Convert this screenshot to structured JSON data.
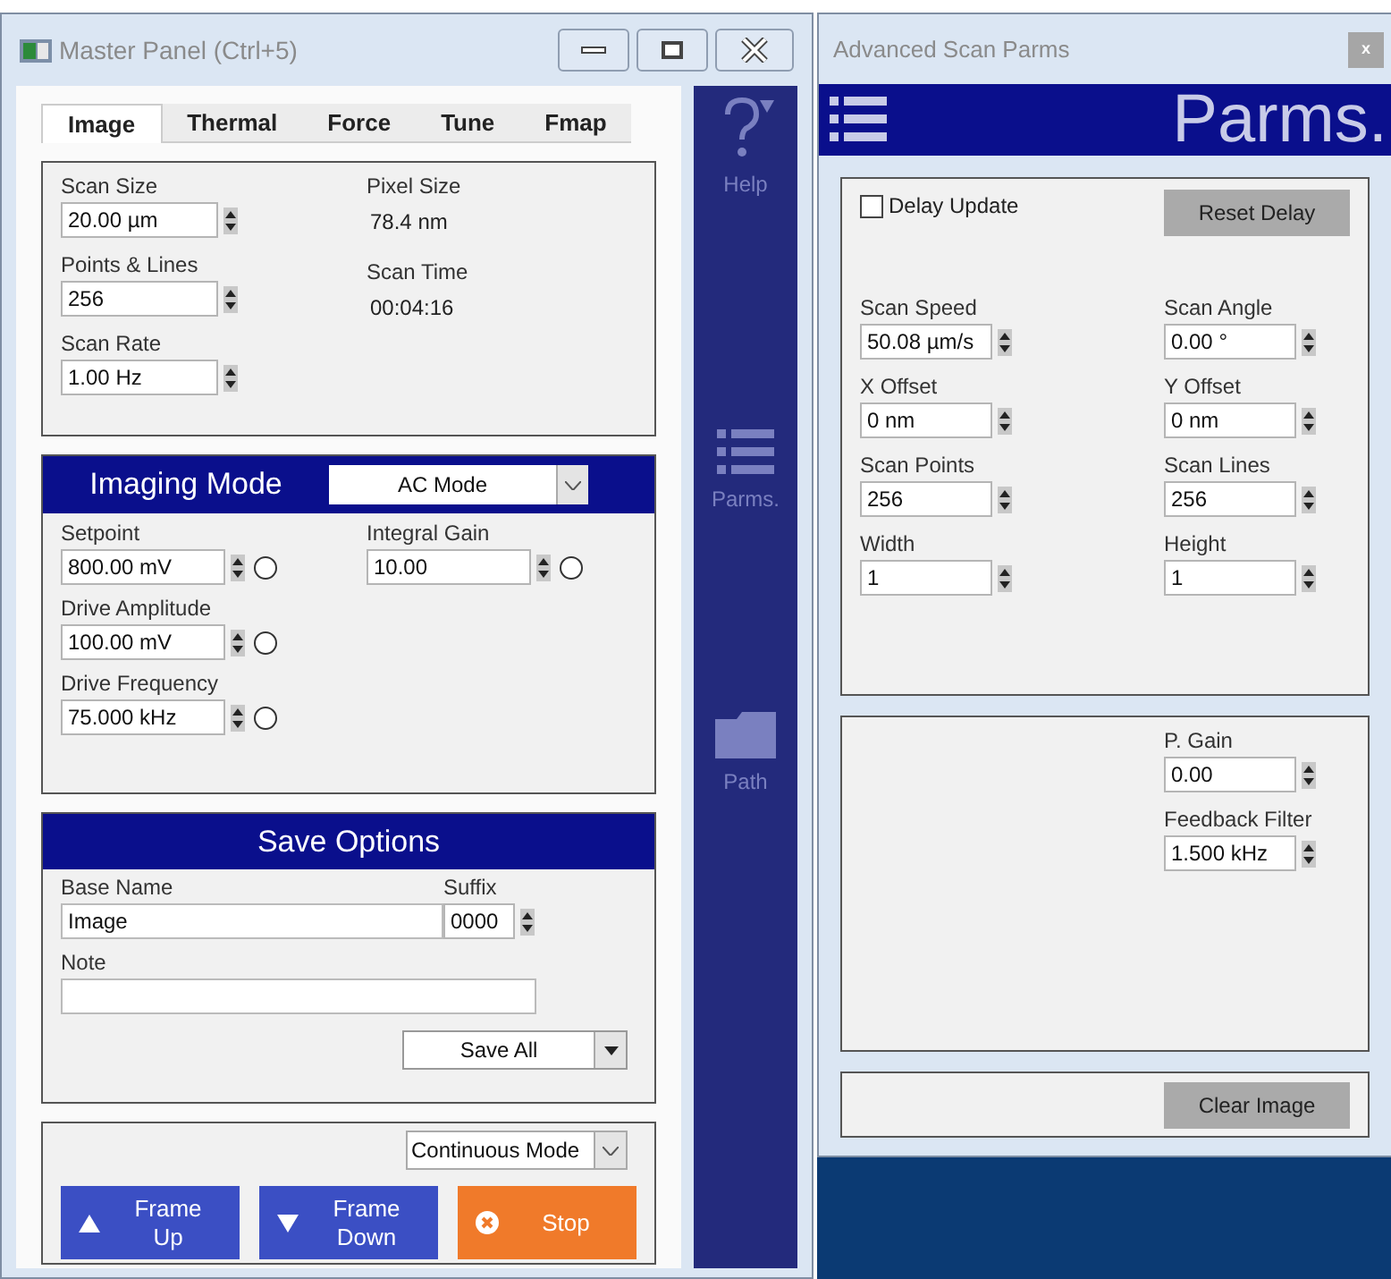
{
  "master": {
    "title": "Master Panel (Ctrl+5)",
    "tabs": [
      {
        "label": "Image",
        "selected": true
      },
      {
        "label": "Thermal",
        "selected": false
      },
      {
        "label": "Force",
        "selected": false
      },
      {
        "label": "Tune",
        "selected": false
      },
      {
        "label": "Fmap",
        "selected": false
      }
    ],
    "image_fields": [
      {
        "label": "Scan Size",
        "value": "20.00 µm"
      },
      {
        "label": "Points & Lines",
        "value": "256"
      },
      {
        "label": "Scan Rate",
        "value": "1.00 Hz"
      }
    ],
    "image_info": [
      {
        "label": "Pixel Size",
        "value": "78.4 nm"
      },
      {
        "label": "Scan Time",
        "value": "00:04:16"
      }
    ],
    "imaging_mode": {
      "title": "Imaging Mode",
      "mode": "AC Mode",
      "rows": [
        [
          {
            "label": "Setpoint",
            "value": "800.00 mV",
            "on": false
          },
          {
            "label": "Integral Gain",
            "value": "10.00",
            "on": false
          }
        ],
        [
          {
            "label": "Drive Amplitude",
            "value": "100.00 mV",
            "on": false
          }
        ],
        [
          {
            "label": "Drive Frequency",
            "value": "75.000 kHz",
            "on": false
          }
        ]
      ]
    },
    "save_options": {
      "title": "Save Options",
      "base_name_label": "Base Name",
      "base_name": "Image",
      "suffix_label": "Suffix",
      "suffix": "0000",
      "note_label": "Note",
      "save_button": "Save All"
    },
    "scan_mode": "Continuous Mode",
    "actions": [
      {
        "kind": "up",
        "label": "Frame Up"
      },
      {
        "kind": "down",
        "label": "Frame Down"
      },
      {
        "kind": "stop",
        "label": "Stop"
      }
    ],
    "nav": [
      {
        "kind": "help",
        "label": "Help"
      },
      {
        "kind": "list",
        "label": "Parms."
      },
      {
        "kind": "folder",
        "label": "Path"
      }
    ]
  },
  "advanced": {
    "title": "Advanced Scan Parms",
    "close": "x",
    "header": "Parms.",
    "delay_update": {
      "label": "Delay Update",
      "checked": false
    },
    "reset_button": "Reset Delay",
    "rows": [
      [
        {
          "label": "Scan Speed",
          "value": "50.08 µm/s"
        },
        {
          "label": "Scan Angle",
          "value": "0.00 °"
        }
      ],
      [
        {
          "label": "X Offset",
          "value": "0 nm"
        },
        {
          "label": "Y Offset",
          "value": "0 nm"
        }
      ],
      [
        {
          "label": "Scan Points",
          "value": "256"
        },
        {
          "label": "Scan Lines",
          "value": "256"
        }
      ],
      [
        {
          "label": "Width",
          "value": "1"
        },
        {
          "label": "Height",
          "value": "1"
        }
      ]
    ],
    "feedback": [
      {
        "label": "P. Gain",
        "value": "0.00"
      },
      {
        "label": "Feedback Filter",
        "value": "1.500 kHz"
      }
    ],
    "clear_button": "Clear Image"
  }
}
